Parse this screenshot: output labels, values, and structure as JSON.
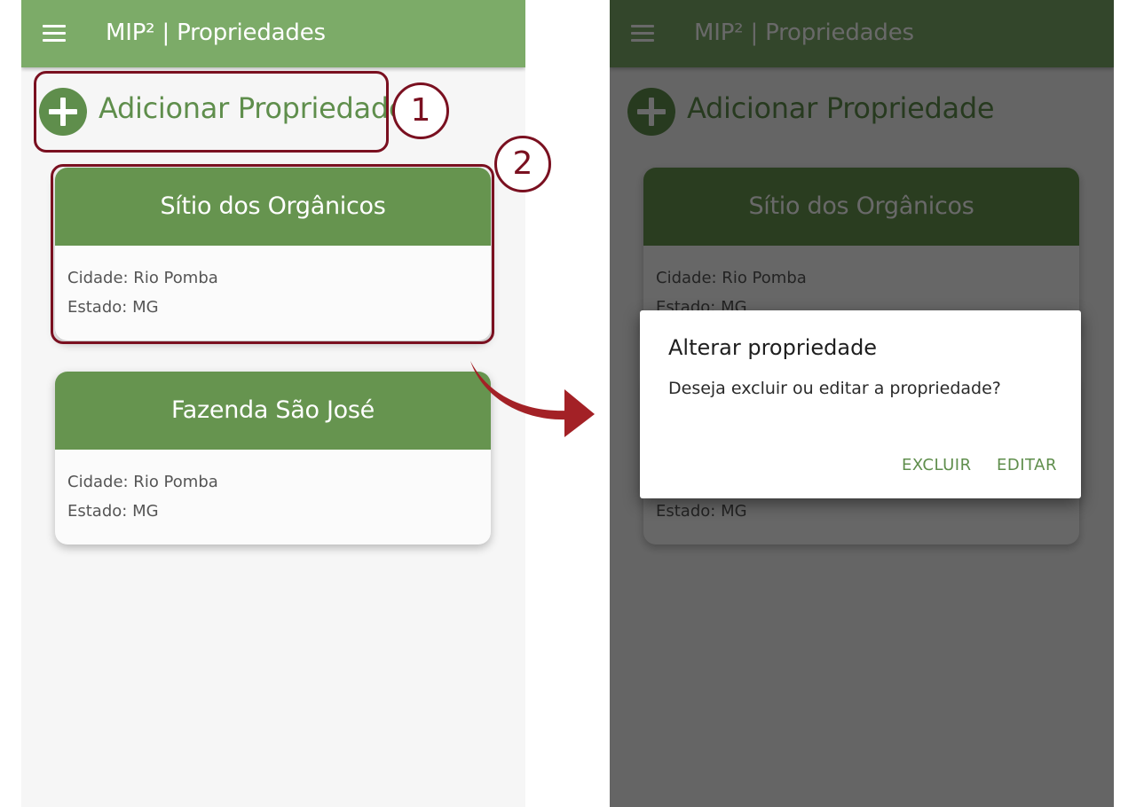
{
  "app_bar": {
    "title": "MIP² | Propriedades",
    "menu_icon": "hamburger-menu-icon"
  },
  "add_property": {
    "label": "Adicionar Propriedade",
    "icon": "plus-circle-icon"
  },
  "properties": [
    {
      "name": "Sítio dos Orgânicos",
      "city": "Cidade: Rio Pomba",
      "state": "Estado: MG"
    },
    {
      "name": "Fazenda São José",
      "city": "Cidade: Rio Pomba",
      "state": "Estado: MG"
    }
  ],
  "callouts": {
    "one": "1",
    "two": "2"
  },
  "dialog": {
    "title": "Alterar propriedade",
    "message": "Deseja excluir ou editar a propriedade?",
    "delete_label": "EXCLUIR",
    "edit_label": "EDITAR"
  },
  "colors": {
    "app_bar": "#7cab68",
    "accent_green": "#5f8e4c",
    "card_header": "#66944f",
    "highlight": "#7a1020",
    "arrow": "#a32126"
  }
}
